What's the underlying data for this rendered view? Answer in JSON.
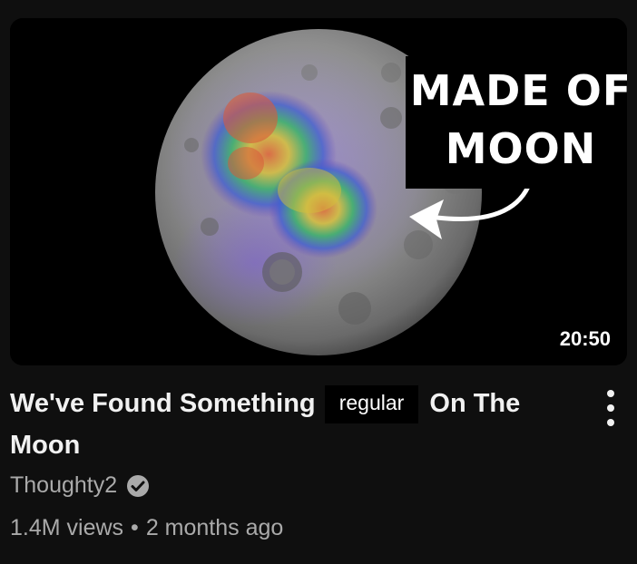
{
  "thumbnail": {
    "overlay_line1": "MADE OF",
    "overlay_line2": "MOON",
    "duration": "20:50"
  },
  "video": {
    "title_part1": "We've Found Something",
    "title_highlight": "regular",
    "title_part2": "On The Moon",
    "channel": "Thoughty2",
    "views": "1.4M views",
    "separator": "•",
    "age": "2 months ago"
  },
  "icons": {
    "verified": "verified-check-icon",
    "menu": "more-vert-icon"
  },
  "colors": {
    "background": "#0f0f0f",
    "title": "#f1f1f1",
    "secondary": "#aaaaaa"
  }
}
